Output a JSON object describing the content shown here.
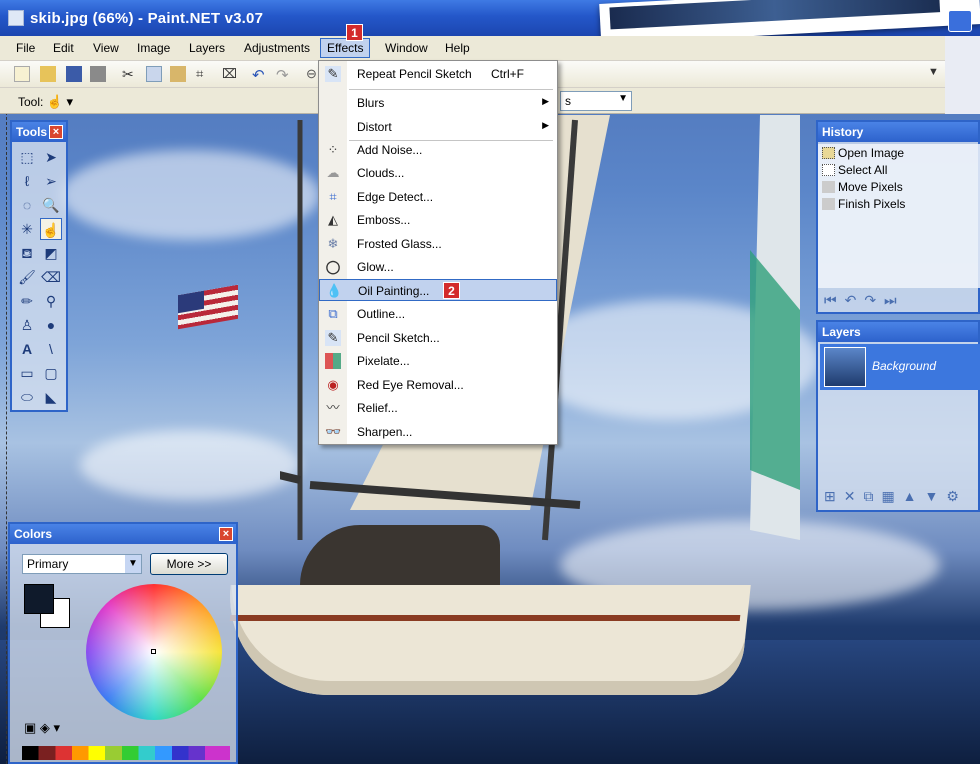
{
  "window": {
    "title": "skib.jpg (66%) - Paint.NET v3.07"
  },
  "menubar": {
    "items": [
      "File",
      "Edit",
      "View",
      "Image",
      "Layers",
      "Adjustments",
      "Effects",
      "Window",
      "Help"
    ],
    "active": "Effects"
  },
  "toolbar2": {
    "tool_label": "Tool:",
    "zoom_value": "s"
  },
  "effects_menu": {
    "repeat_label": "Repeat Pencil Sketch",
    "repeat_shortcut": "Ctrl+F",
    "items": [
      {
        "label": "Blurs",
        "icon": "blurs-icon",
        "submenu": true
      },
      {
        "label": "Distort",
        "icon": "distort-icon",
        "submenu": true
      },
      {
        "label": "Add Noise...",
        "icon": "noise-icon"
      },
      {
        "label": "Clouds...",
        "icon": "clouds-icon"
      },
      {
        "label": "Edge Detect...",
        "icon": "edge-detect-icon"
      },
      {
        "label": "Emboss...",
        "icon": "emboss-icon"
      },
      {
        "label": "Frosted Glass...",
        "icon": "frosted-glass-icon"
      },
      {
        "label": "Glow...",
        "icon": "glow-icon"
      },
      {
        "label": "Oil Painting...",
        "icon": "oil-painting-icon",
        "highlighted": true
      },
      {
        "label": "Outline...",
        "icon": "outline-icon"
      },
      {
        "label": "Pencil Sketch...",
        "icon": "pencil-sketch-icon"
      },
      {
        "label": "Pixelate...",
        "icon": "pixelate-icon"
      },
      {
        "label": "Red Eye Removal...",
        "icon": "red-eye-icon"
      },
      {
        "label": "Relief...",
        "icon": "relief-icon"
      },
      {
        "label": "Sharpen...",
        "icon": "sharpen-icon"
      }
    ]
  },
  "callouts": {
    "one": "1",
    "two": "2"
  },
  "tools_panel": {
    "title": "Tools"
  },
  "colors_panel": {
    "title": "Colors",
    "selector": "Primary",
    "more_button": "More >>"
  },
  "history_panel": {
    "title": "History",
    "items": [
      "Open Image",
      "Select All",
      "Move Pixels",
      "Finish Pixels"
    ]
  },
  "layers_panel": {
    "title": "Layers",
    "layer_name": "Background"
  },
  "colors": {
    "title_bar": "#2457c9",
    "menu_bg": "#ece9d8",
    "menu_highlight": "#c1d2ee",
    "callout": "#d32b2b"
  }
}
